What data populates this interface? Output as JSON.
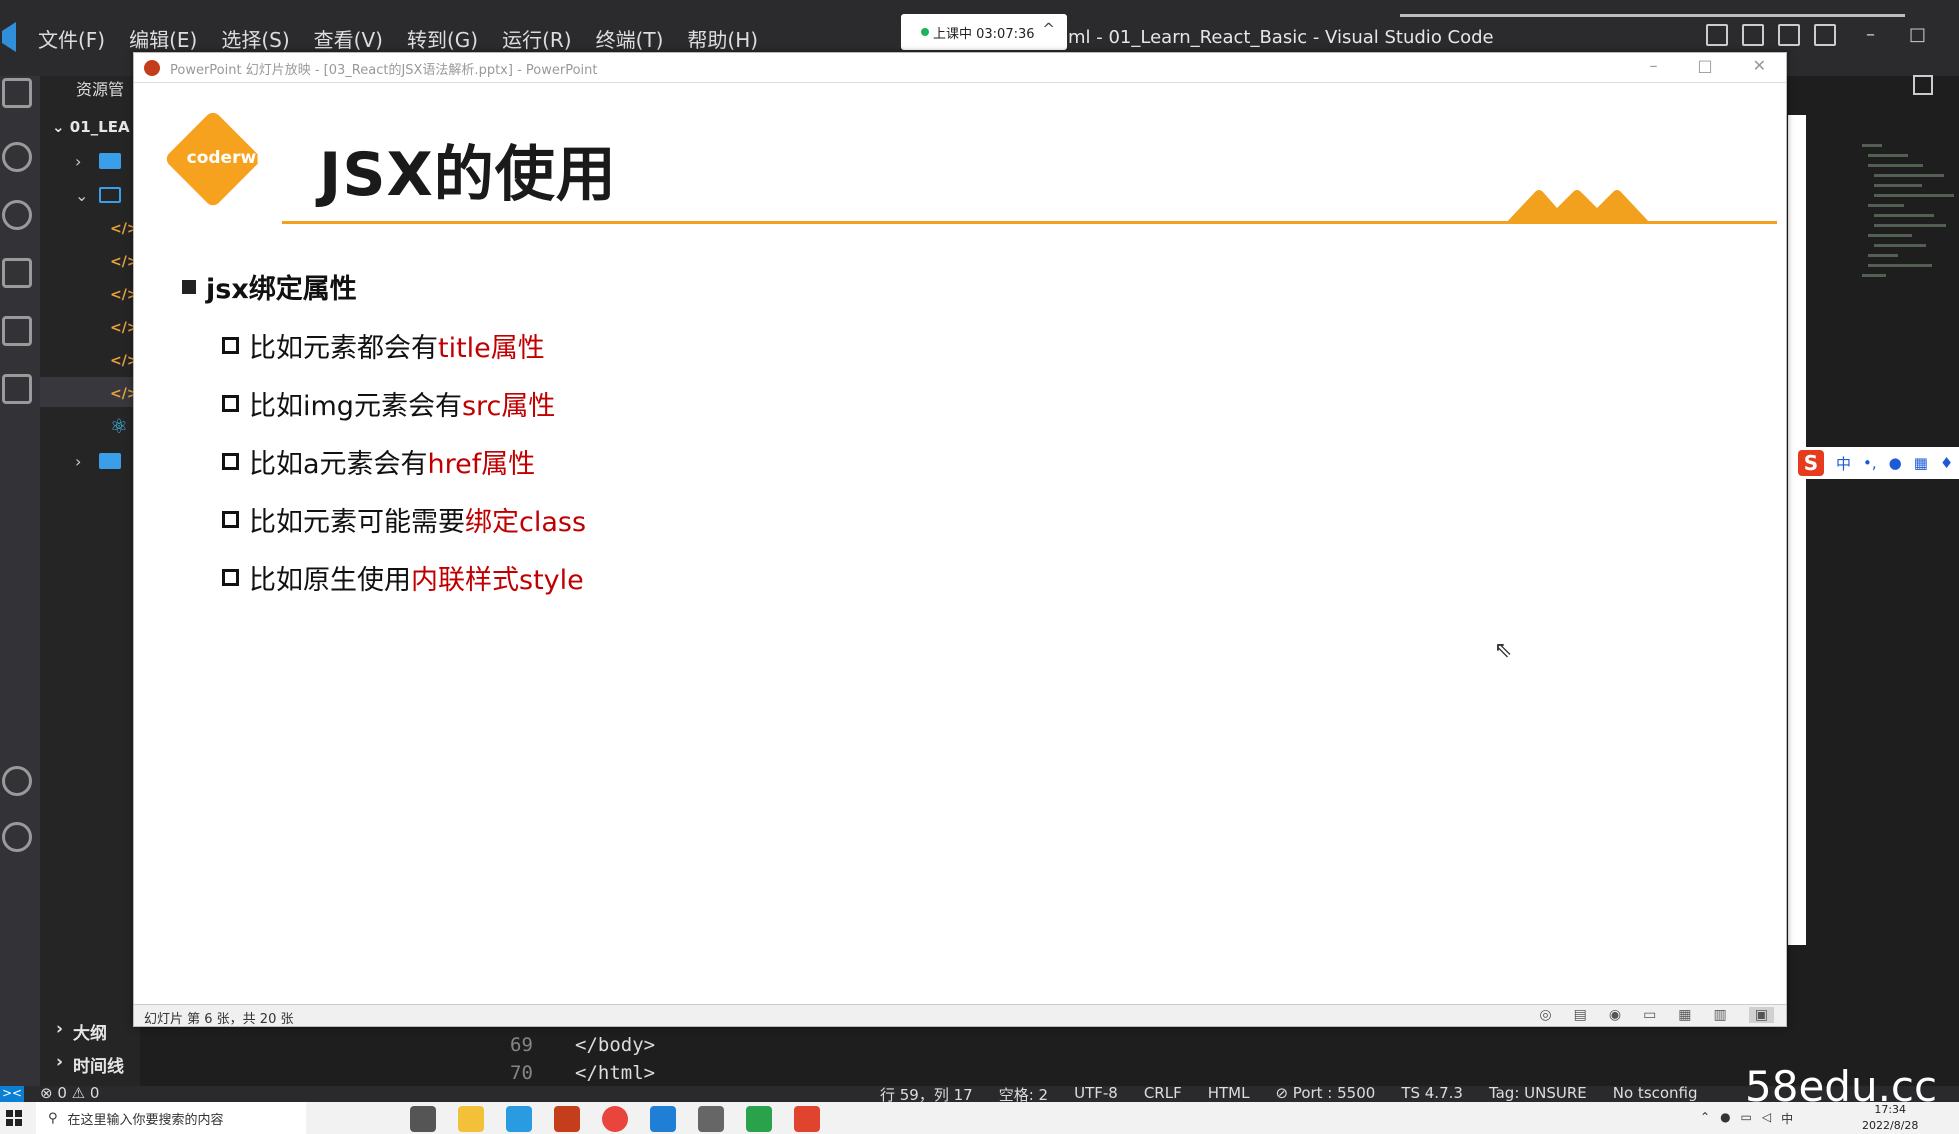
{
  "vscode": {
    "menu": [
      "文件(F)",
      "编辑(E)",
      "选择(S)",
      "查看(V)",
      "转到(G)",
      "运行(R)",
      "终端(T)",
      "帮助(H)"
    ],
    "window_title": "ml - 01_Learn_React_Basic - Visual Studio Code",
    "recording": {
      "label": "上课中 03:07:36",
      "caret": "^"
    },
    "explorer": {
      "header": "资源管",
      "root": "01_LEA",
      "outline": "大纲",
      "timeline": "时间线"
    },
    "editor": {
      "lines": [
        {
          "number": "69",
          "code": "</body>"
        },
        {
          "number": "70",
          "code": "</html>"
        }
      ]
    },
    "status": {
      "problems": "⊗ 0 ⚠ 0",
      "items": [
        "行 59，列 17",
        "空格: 2",
        "UTF-8",
        "CRLF",
        "HTML",
        "⊘ Port : 5500",
        "TS 4.7.3",
        "Tag: UNSURE",
        "No tsconfig"
      ]
    }
  },
  "powerpoint": {
    "window_title": "PowerPoint 幻灯片放映 - [03_React的JSX语法解析.pptx] - PowerPoint",
    "slide": {
      "logo_text": "coderwhy",
      "title": "JSX的使用",
      "level1": "jsx绑定属性",
      "bullets": [
        {
          "text": "比如元素都会有",
          "highlight": "title属性"
        },
        {
          "text": "比如img元素会有",
          "highlight": "src属性"
        },
        {
          "text": "比如a元素会有",
          "highlight": "href属性"
        },
        {
          "text": "比如元素可能需要",
          "highlight": "绑定class"
        },
        {
          "text": "比如原生使用",
          "highlight": "内联样式style"
        }
      ]
    },
    "statusbar": {
      "slide_number": "幻灯片 第 6 张，共 20 张"
    }
  },
  "taskbar": {
    "search_placeholder": "在这里输入你要搜索的内容",
    "clock_time": "17:34",
    "clock_date": "2022/8/28"
  },
  "watermark": "58edu.cc",
  "colors": {
    "accent_orange": "#f2a11f",
    "highlight_red": "#c00000"
  }
}
